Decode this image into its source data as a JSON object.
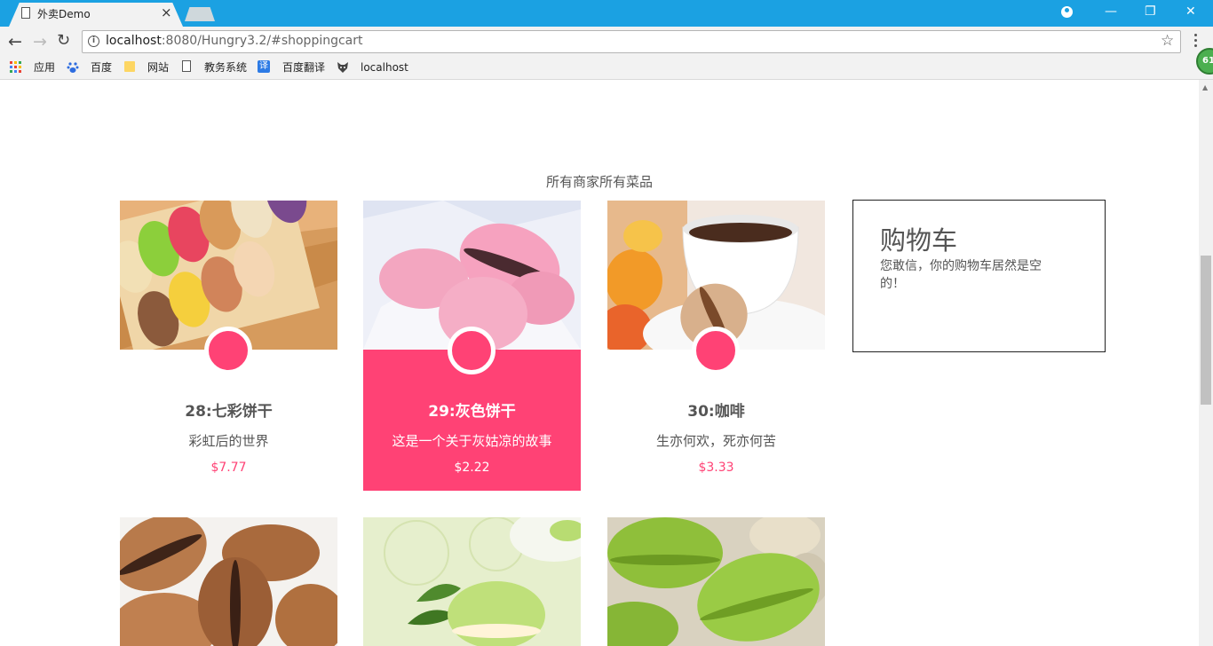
{
  "browser": {
    "tab_title": "外卖Demo",
    "tab_close": "×",
    "url_host": "localhost",
    "url_rest": ":8080/Hungry3.2/#shoppingcart",
    "bookmarks": [
      {
        "label": "应用",
        "icon": "apps-grid-icon"
      },
      {
        "label": "百度",
        "icon": "baidu-paw-icon"
      },
      {
        "label": "网站",
        "icon": "folder-icon"
      },
      {
        "label": "教务系统",
        "icon": "page-icon"
      },
      {
        "label": "百度翻译",
        "icon": "translate-icon",
        "icon_text": "译"
      },
      {
        "label": "localhost",
        "icon": "fox-icon"
      }
    ],
    "extension_badge": "61",
    "window_buttons": {
      "minimize": "—",
      "restore": "❐",
      "close": "✕"
    }
  },
  "page": {
    "section_title": "所有商家所有菜品",
    "products": [
      {
        "name": "28:七彩饼干",
        "desc": "彩虹后的世界",
        "price": "$7.77",
        "highlighted": false
      },
      {
        "name": "29:灰色饼干",
        "desc": "这是一个关于灰姑凉的故事",
        "price": "$2.22",
        "highlighted": true
      },
      {
        "name": "30:咖啡",
        "desc": "生亦何欢，死亦何苦",
        "price": "$3.33",
        "highlighted": false
      }
    ],
    "cart": {
      "title": "购物车",
      "message": "您敢信，你的购物车居然是空的！"
    }
  },
  "colors": {
    "accent": "#ff4275",
    "titlebar": "#1ba1e2"
  }
}
